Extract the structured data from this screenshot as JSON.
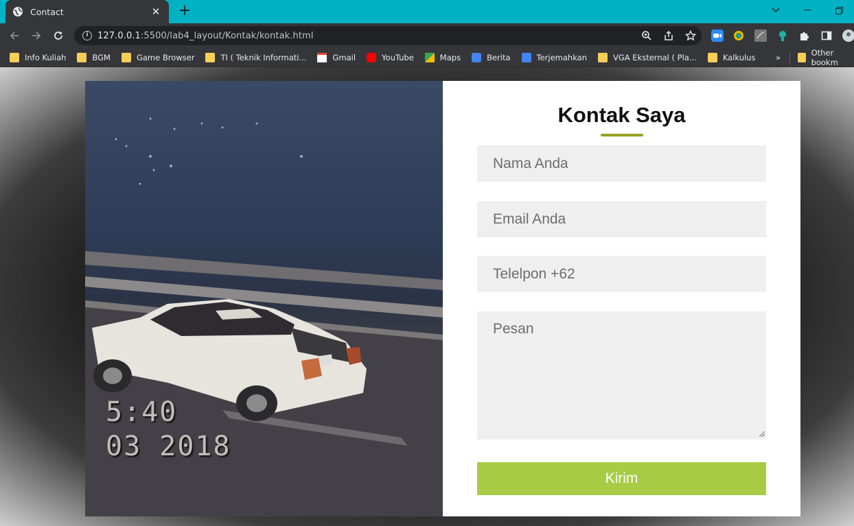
{
  "browser": {
    "tab_title": "Contact",
    "url_host": "127.0.0.1",
    "url_rest": ":5500/lab4_layout/Kontak/kontak.html",
    "bookmarks": [
      {
        "label": "Info Kuliah",
        "icon": "folder-icon"
      },
      {
        "label": "BGM",
        "icon": "folder-icon"
      },
      {
        "label": "Game Browser",
        "icon": "folder-icon"
      },
      {
        "label": "TI ( Teknik Informati...",
        "icon": "folder-icon"
      },
      {
        "label": "Gmail",
        "icon": "gmail-icon"
      },
      {
        "label": "YouTube",
        "icon": "youtube-icon"
      },
      {
        "label": "Maps",
        "icon": "maps-icon"
      },
      {
        "label": "Berita",
        "icon": "news-icon"
      },
      {
        "label": "Terjemahkan",
        "icon": "translate-icon"
      },
      {
        "label": "VGA Eksternal ( Pla...",
        "icon": "folder-icon"
      },
      {
        "label": "Kalkulus",
        "icon": "folder-icon"
      }
    ],
    "other_bookmarks": "Other bookm"
  },
  "photo": {
    "time_stamp": "5:40",
    "date_stamp": "03 2018"
  },
  "form": {
    "heading": "Kontak Saya",
    "name_placeholder": "Nama Anda",
    "email_placeholder": "Email Anda",
    "phone_placeholder": "Telelpon +62",
    "message_placeholder": "Pesan",
    "submit_label": "Kirim"
  },
  "colors": {
    "tabstrip": "#00b2c3",
    "accent_underline": "#9aa11f",
    "submit_bg": "#a8cb45"
  }
}
